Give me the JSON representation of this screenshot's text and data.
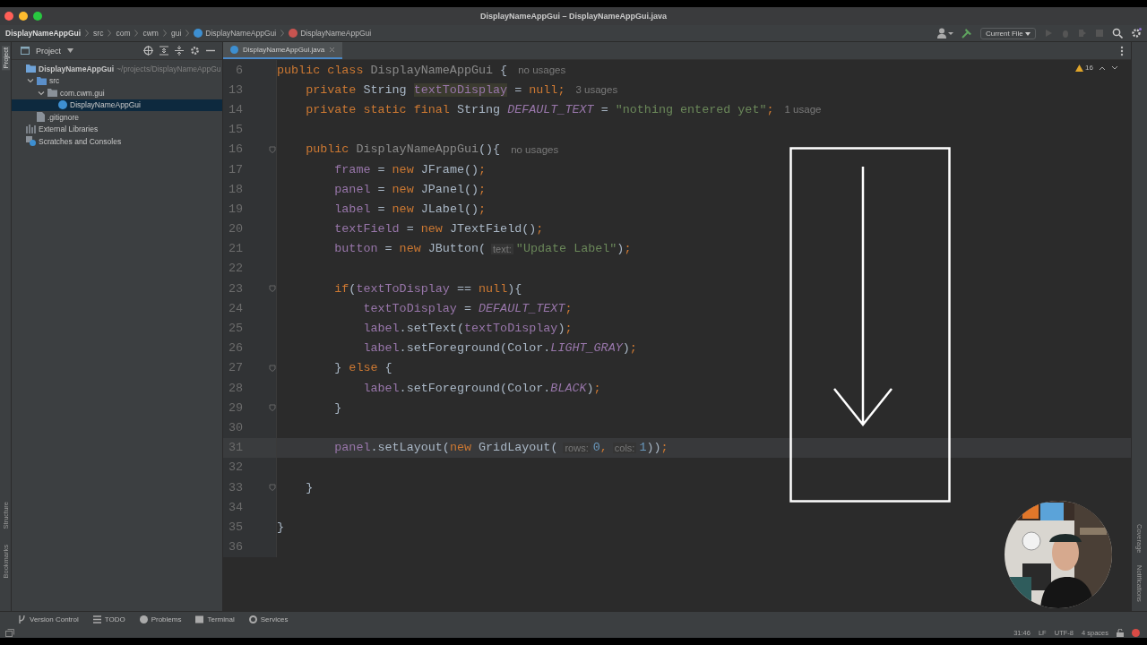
{
  "window": {
    "title": "DisplayNameAppGui – DisplayNameAppGui.java"
  },
  "breadcrumbs": [
    {
      "label": "DisplayNameAppGui",
      "kind": "project"
    },
    {
      "label": "src",
      "kind": "dir"
    },
    {
      "label": "com",
      "kind": "dir"
    },
    {
      "label": "cwm",
      "kind": "dir"
    },
    {
      "label": "gui",
      "kind": "dir"
    },
    {
      "label": "DisplayNameAppGui",
      "kind": "class"
    },
    {
      "label": "DisplayNameAppGui",
      "kind": "method"
    }
  ],
  "toolbar": {
    "run_config": "Current File"
  },
  "left_stripe": [
    {
      "label": "Project",
      "selected": true
    },
    {
      "label": "Structure",
      "selected": false
    },
    {
      "label": "Bookmarks",
      "selected": false
    }
  ],
  "right_stripe": [
    {
      "label": "Coverage"
    },
    {
      "label": "Notifications"
    }
  ],
  "project_panel": {
    "title": "Project",
    "tree": [
      {
        "label": "DisplayNameAppGui",
        "path": "~/projects/DisplayNameAppGu",
        "kind": "module",
        "selected": false,
        "children": [
          {
            "label": "src",
            "kind": "folder",
            "expanded": true,
            "selected": false,
            "children": [
              {
                "label": "com.cwm.gui",
                "kind": "package",
                "expanded": true,
                "selected": false,
                "children": [
                  {
                    "label": "DisplayNameAppGui",
                    "kind": "class",
                    "selected": true
                  }
                ]
              }
            ]
          },
          {
            "label": ".gitignore",
            "kind": "file",
            "selected": false
          }
        ]
      },
      {
        "label": "External Libraries",
        "kind": "libraries",
        "selected": false
      },
      {
        "label": "Scratches and Consoles",
        "kind": "scratches",
        "selected": false
      }
    ]
  },
  "tabs": [
    {
      "label": "DisplayNameAppGui.java",
      "selected": true
    }
  ],
  "inspections": {
    "warnings": "16"
  },
  "code": [
    {
      "n": "6",
      "fold": false,
      "current": false,
      "tokens": [
        {
          "kind": "kw",
          "text": "public class "
        },
        {
          "kind": "unused",
          "text": "DisplayNameAppGui"
        },
        {
          "kind": "plain",
          "text": " {"
        },
        {
          "kind": "usage",
          "text": "no usages"
        }
      ]
    },
    {
      "n": "13",
      "fold": false,
      "current": false,
      "tokens": [
        {
          "kind": "kw",
          "text": "    private "
        },
        {
          "kind": "plain",
          "text": "String "
        },
        {
          "kind": "mark",
          "text": "textToDisplay"
        },
        {
          "kind": "plain",
          "text": " = "
        },
        {
          "kind": "kw",
          "text": "null;"
        },
        {
          "kind": "usage",
          "text": "3 usages"
        }
      ]
    },
    {
      "n": "14",
      "fold": false,
      "current": false,
      "tokens": [
        {
          "kind": "kw",
          "text": "    private static final "
        },
        {
          "kind": "plain",
          "text": "String "
        },
        {
          "kind": "const",
          "text": "DEFAULT_TEXT"
        },
        {
          "kind": "plain",
          "text": " = "
        },
        {
          "kind": "str",
          "text": "\"nothing entered yet\""
        },
        {
          "kind": "kw",
          "text": ";"
        },
        {
          "kind": "usage",
          "text": "1 usage"
        }
      ]
    },
    {
      "n": "15",
      "fold": false,
      "current": false
    },
    {
      "n": "16",
      "fold": true,
      "current": false,
      "tokens": [
        {
          "kind": "kw",
          "text": "    public "
        },
        {
          "kind": "unused",
          "text": "DisplayNameAppGui"
        },
        {
          "kind": "plain",
          "text": "(){"
        },
        {
          "kind": "usage",
          "text": "no usages"
        }
      ]
    },
    {
      "n": "17",
      "fold": false,
      "current": false,
      "tokens": [
        {
          "kind": "field",
          "text": "        frame"
        },
        {
          "kind": "plain",
          "text": " = "
        },
        {
          "kind": "kw",
          "text": "new "
        },
        {
          "kind": "plain",
          "text": "JFrame()"
        },
        {
          "kind": "kw",
          "text": ";"
        }
      ]
    },
    {
      "n": "18",
      "fold": false,
      "current": false,
      "tokens": [
        {
          "kind": "field",
          "text": "        panel"
        },
        {
          "kind": "plain",
          "text": " = "
        },
        {
          "kind": "kw",
          "text": "new "
        },
        {
          "kind": "plain",
          "text": "JPanel()"
        },
        {
          "kind": "kw",
          "text": ";"
        }
      ]
    },
    {
      "n": "19",
      "fold": false,
      "current": false,
      "tokens": [
        {
          "kind": "field",
          "text": "        label"
        },
        {
          "kind": "plain",
          "text": " = "
        },
        {
          "kind": "kw",
          "text": "new "
        },
        {
          "kind": "plain",
          "text": "JLabel()"
        },
        {
          "kind": "kw",
          "text": ";"
        }
      ]
    },
    {
      "n": "20",
      "fold": false,
      "current": false,
      "tokens": [
        {
          "kind": "field",
          "text": "        textField"
        },
        {
          "kind": "plain",
          "text": " = "
        },
        {
          "kind": "kw",
          "text": "new "
        },
        {
          "kind": "plain",
          "text": "JTextField()"
        },
        {
          "kind": "kw",
          "text": ";"
        }
      ]
    },
    {
      "n": "21",
      "fold": false,
      "current": false,
      "tokens": [
        {
          "kind": "field",
          "text": "        button"
        },
        {
          "kind": "plain",
          "text": " = "
        },
        {
          "kind": "kw",
          "text": "new "
        },
        {
          "kind": "plain",
          "text": "JButton("
        },
        {
          "kind": "hint",
          "text": "text:"
        },
        {
          "kind": "str",
          "text": "\"Update Label\""
        },
        {
          "kind": "plain",
          "text": ")"
        },
        {
          "kind": "kw",
          "text": ";"
        }
      ]
    },
    {
      "n": "22",
      "fold": false,
      "current": false
    },
    {
      "n": "23",
      "fold": true,
      "current": false,
      "tokens": [
        {
          "kind": "kw",
          "text": "        if"
        },
        {
          "kind": "plain",
          "text": "("
        },
        {
          "kind": "field",
          "text": "textToDisplay"
        },
        {
          "kind": "plain",
          "text": " == "
        },
        {
          "kind": "kw",
          "text": "null"
        },
        {
          "kind": "plain",
          "text": "){"
        }
      ]
    },
    {
      "n": "24",
      "fold": false,
      "current": false,
      "tokens": [
        {
          "kind": "field",
          "text": "            textToDisplay"
        },
        {
          "kind": "plain",
          "text": " = "
        },
        {
          "kind": "const",
          "text": "DEFAULT_TEXT"
        },
        {
          "kind": "kw",
          "text": ";"
        }
      ]
    },
    {
      "n": "25",
      "fold": false,
      "current": false,
      "tokens": [
        {
          "kind": "field",
          "text": "            label"
        },
        {
          "kind": "plain",
          "text": ".setText("
        },
        {
          "kind": "field",
          "text": "textToDisplay"
        },
        {
          "kind": "plain",
          "text": ")"
        },
        {
          "kind": "kw",
          "text": ";"
        }
      ]
    },
    {
      "n": "26",
      "fold": false,
      "current": false,
      "tokens": [
        {
          "kind": "field",
          "text": "            label"
        },
        {
          "kind": "plain",
          "text": ".setForeground(Color."
        },
        {
          "kind": "const",
          "text": "LIGHT_GRAY"
        },
        {
          "kind": "plain",
          "text": ")"
        },
        {
          "kind": "kw",
          "text": ";"
        }
      ]
    },
    {
      "n": "27",
      "fold": true,
      "current": false,
      "tokens": [
        {
          "kind": "plain",
          "text": "        } "
        },
        {
          "kind": "kw",
          "text": "else "
        },
        {
          "kind": "plain",
          "text": "{"
        }
      ]
    },
    {
      "n": "28",
      "fold": false,
      "current": false,
      "tokens": [
        {
          "kind": "field",
          "text": "            label"
        },
        {
          "kind": "plain",
          "text": ".setForeground(Color."
        },
        {
          "kind": "const",
          "text": "BLACK"
        },
        {
          "kind": "plain",
          "text": ")"
        },
        {
          "kind": "kw",
          "text": ";"
        }
      ]
    },
    {
      "n": "29",
      "fold": true,
      "current": false,
      "tokens": [
        {
          "kind": "plain",
          "text": "        }"
        }
      ]
    },
    {
      "n": "30",
      "fold": false,
      "current": false
    },
    {
      "n": "31",
      "fold": false,
      "current": true,
      "tokens": [
        {
          "kind": "field",
          "text": "        panel"
        },
        {
          "kind": "plain",
          "text": ".setLayout("
        },
        {
          "kind": "kw",
          "text": "new "
        },
        {
          "kind": "plain",
          "text": "GridLayout("
        },
        {
          "kind": "hint",
          "text": "rows:"
        },
        {
          "kind": "num",
          "text": "0"
        },
        {
          "kind": "kw",
          "text": ","
        },
        {
          "kind": "hint",
          "text": "cols:"
        },
        {
          "kind": "num",
          "text": "1"
        },
        {
          "kind": "plain",
          "text": "))"
        },
        {
          "kind": "kw",
          "text": ";"
        }
      ]
    },
    {
      "n": "32",
      "fold": false,
      "current": false
    },
    {
      "n": "33",
      "fold": true,
      "current": false,
      "tokens": [
        {
          "kind": "plain",
          "text": "    }"
        }
      ]
    },
    {
      "n": "34",
      "fold": false,
      "current": false
    },
    {
      "n": "35",
      "fold": false,
      "current": false,
      "tokens": [
        {
          "kind": "plain",
          "text": "}"
        }
      ]
    },
    {
      "n": "36",
      "fold": false,
      "current": false
    }
  ],
  "tool_windows": [
    {
      "label": "Version Control",
      "kind": "vcs"
    },
    {
      "label": "TODO",
      "kind": "todo"
    },
    {
      "label": "Problems",
      "kind": "problems"
    },
    {
      "label": "Terminal",
      "kind": "terminal"
    },
    {
      "label": "Services",
      "kind": "services"
    }
  ],
  "status_bar": {
    "position": "31:46",
    "line_separator": "LF",
    "encoding": "UTF-8",
    "indent": "4 spaces"
  }
}
